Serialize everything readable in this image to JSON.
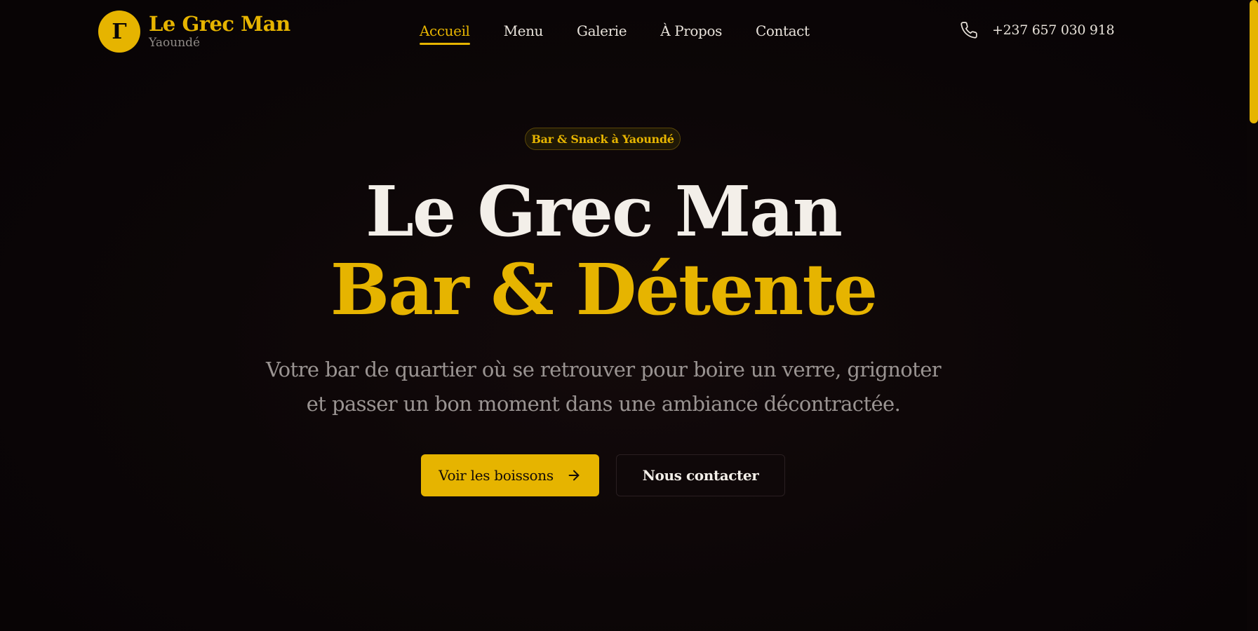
{
  "brand": {
    "logo_letter": "Γ",
    "name": "Le Grec Man",
    "city": "Yaoundé",
    "accent_color": "#e6b400"
  },
  "nav": {
    "items": [
      {
        "label": "Accueil",
        "active": true
      },
      {
        "label": "Menu",
        "active": false
      },
      {
        "label": "Galerie",
        "active": false
      },
      {
        "label": "À Propos",
        "active": false
      },
      {
        "label": "Contact",
        "active": false
      }
    ]
  },
  "contact": {
    "phone_icon": "phone-icon",
    "phone": "+237 657 030 918"
  },
  "hero": {
    "badge": "Bar & Snack à Yaoundé",
    "title_line1": "Le Grec Man",
    "title_line2": "Bar & Détente",
    "description": "Votre bar de quartier où se retrouver pour boire un verre, grignoter et passer un bon moment dans une ambiance décontractée.",
    "primary_button": "Voir les boissons",
    "primary_icon": "arrow-right-icon",
    "secondary_button": "Nous contacter"
  }
}
